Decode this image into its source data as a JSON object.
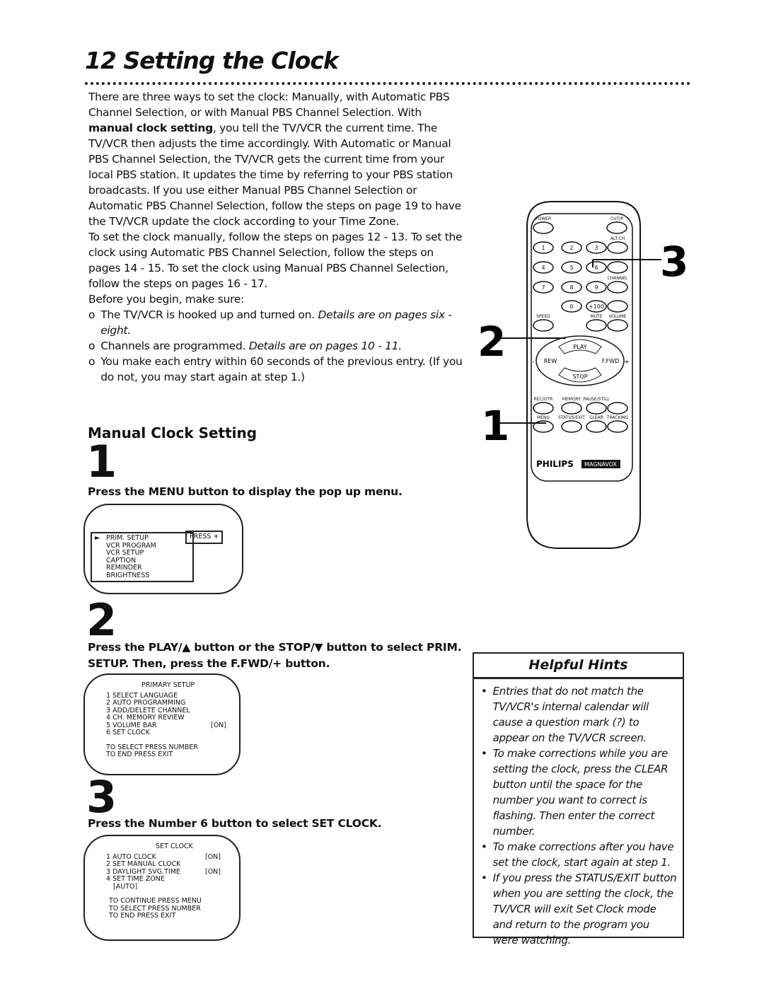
{
  "title": "12 Setting the Clock",
  "intro": {
    "p1_a": "There are three ways to set the clock: Manually, with Automatic PBS Channel Selection, or with Manual PBS Channel Selection. With ",
    "p1_bold": "manual clock setting",
    "p1_b": ", you tell the TV/VCR the current time. The TV/VCR then adjusts the time accordingly. With Automatic or Manual PBS Channel Selection, the TV/VCR gets the current time from your local PBS station. It updates the time by referring to your PBS station broadcasts. If you use either Manual PBS Channel Selection or Automatic PBS Channel Selection, follow the steps on page 19 to have the TV/VCR update the clock according to your Time Zone.",
    "p2": "To set the clock manually, follow the steps on pages 12 - 13. To set the clock using Automatic PBS Channel Selection, follow the steps on pages 14 - 15. To set the clock using Manual PBS Channel Selection, follow the steps on pages 16 - 17.",
    "p3": "Before you begin, make sure:",
    "bullets": [
      {
        "text": "The TV/VCR is hooked up and turned on. ",
        "ref": "Details are on pages six - eight."
      },
      {
        "text": "Channels are programmed. ",
        "ref": "Details are on pages 10 - 11."
      },
      {
        "text": "You make each entry within 60 seconds of the previous entry. (If you do not, you may start again at step 1.)",
        "ref": ""
      }
    ],
    "bullet_marker": "o"
  },
  "section_heading": "Manual Clock Setting",
  "steps": [
    {
      "number": "1",
      "text": "Press the MENU button to display the pop up menu."
    },
    {
      "number": "2",
      "text": "Press the PLAY/▲ button or the STOP/▼ button to select PRIM. SETUP. Then, press the F.FWD/+ button."
    },
    {
      "number": "3",
      "text": "Press the Number 6 button to select SET CLOCK."
    }
  ],
  "screen1": {
    "items": [
      "PRIM. SETUP",
      "VCR PROGRAM",
      "VCR SETUP",
      "CAPTION",
      "REMINDER",
      "BRIGHTNESS"
    ],
    "press": "PRESS +",
    "arrow": "►"
  },
  "screen2": {
    "title": "PRIMARY SETUP",
    "items": [
      [
        "1 SELECT LANGUAGE",
        ""
      ],
      [
        "2 AUTO PROGRAMMING",
        ""
      ],
      [
        "3 ADD/DELETE CHANNEL",
        ""
      ],
      [
        "4 CH. MEMORY REVIEW",
        ""
      ],
      [
        "5 VOLUME BAR",
        "[ON]"
      ],
      [
        "6 SET CLOCK",
        ""
      ]
    ],
    "footer": [
      "TO SELECT PRESS NUMBER",
      "TO END PRESS EXIT"
    ]
  },
  "screen3": {
    "title": "SET CLOCK",
    "items": [
      [
        "1 AUTO CLOCK",
        "[ON]"
      ],
      [
        "2 SET MANUAL CLOCK",
        ""
      ],
      [
        "3 DAYLIGHT SVG.TIME",
        "[ON]"
      ],
      [
        "4 SET TIME ZONE",
        ""
      ],
      [
        "   [AUTO]",
        ""
      ]
    ],
    "footer": [
      "TO CONTINUE PRESS MENU",
      "TO SELECT PRESS NUMBER",
      "TO END PRESS EXIT"
    ]
  },
  "remote": {
    "labels": {
      "power": "POWER",
      "cutp": "CUT/P",
      "altch": "ALT.CH",
      "channel": "CHANNEL",
      "volume": "VOLUME",
      "speed": "SPEED",
      "mute": "MUTE",
      "play": "PLAY",
      "stop": "STOP",
      "rew": "REW",
      "ffwd": "F.FWD",
      "minus": "-",
      "plus": "+",
      "recotr": "REC/OTR",
      "memory": "MEMORY",
      "pause": "PAUSE/STILL",
      "menu": "MENU",
      "status": "STATUS/EXIT",
      "clear": "CLEAR",
      "tracking": "TRACKING",
      "hundred": "+100"
    },
    "digits": [
      "1",
      "2",
      "3",
      "4",
      "5",
      "6",
      "7",
      "8",
      "9",
      "0"
    ],
    "brand": "PHILIPS",
    "brand2": "MAGNAVOX",
    "callouts": [
      "1",
      "2",
      "3"
    ]
  },
  "hints": {
    "title": "Helpful Hints",
    "items": [
      "Entries that do not match the TV/VCR's internal calendar will cause a question mark (?) to appear on the TV/VCR screen.",
      "To make corrections while you are setting the clock, press the CLEAR button until the space for the number you want to correct is flashing. Then enter the correct number.",
      "To make corrections after you have set the clock, start again at step 1.",
      "If you press the STATUS/EXIT button when you are setting the clock, the TV/VCR will exit Set Clock mode and return to the program you were watching."
    ],
    "bullet": "•"
  }
}
